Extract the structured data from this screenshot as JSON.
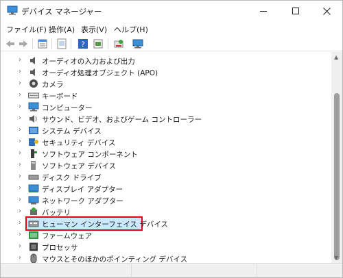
{
  "window": {
    "title": "デバイス マネージャー",
    "accent": "#e60012"
  },
  "menu": [
    "ファイル(F)",
    "操作(A)",
    "表示(V)",
    "ヘルプ(H)"
  ],
  "toolbar_icons": [
    "back-icon",
    "forward-icon",
    "properties-icon",
    "update-driver-icon",
    "help-icon",
    "scan-hardware-icon",
    "uninstall-icon",
    "monitor-icon"
  ],
  "devices": [
    {
      "label": "オーディオの入力および出力",
      "icon": "speaker-icon"
    },
    {
      "label": "オーディオ処理オブジェクト (APO)",
      "icon": "speaker-icon"
    },
    {
      "label": "カメラ",
      "icon": "camera-icon"
    },
    {
      "label": "キーボード",
      "icon": "keyboard-icon"
    },
    {
      "label": "コンピューター",
      "icon": "computer-icon"
    },
    {
      "label": "サウンド、ビデオ、およびゲーム コントローラー",
      "icon": "sound-icon"
    },
    {
      "label": "システム デバイス",
      "icon": "system-icon"
    },
    {
      "label": "セキュリティ デバイス",
      "icon": "security-icon"
    },
    {
      "label": "ソフトウェア コンポーネント",
      "icon": "software-component-icon"
    },
    {
      "label": "ソフトウェア デバイス",
      "icon": "software-device-icon"
    },
    {
      "label": "ディスク ドライブ",
      "icon": "disk-icon"
    },
    {
      "label": "ディスプレイ アダプター",
      "icon": "display-icon"
    },
    {
      "label": "ネットワーク アダプター",
      "icon": "network-icon"
    },
    {
      "label": "バッテリ",
      "icon": "battery-icon"
    },
    {
      "label": "ヒューマン インターフェイス デバイス",
      "icon": "hid-icon",
      "selected": true
    },
    {
      "label": "ファームウェア",
      "icon": "firmware-icon"
    },
    {
      "label": "プロセッサ",
      "icon": "processor-icon"
    },
    {
      "label": "マウスとそのほかのポインティング デバイス",
      "icon": "mouse-icon"
    }
  ]
}
